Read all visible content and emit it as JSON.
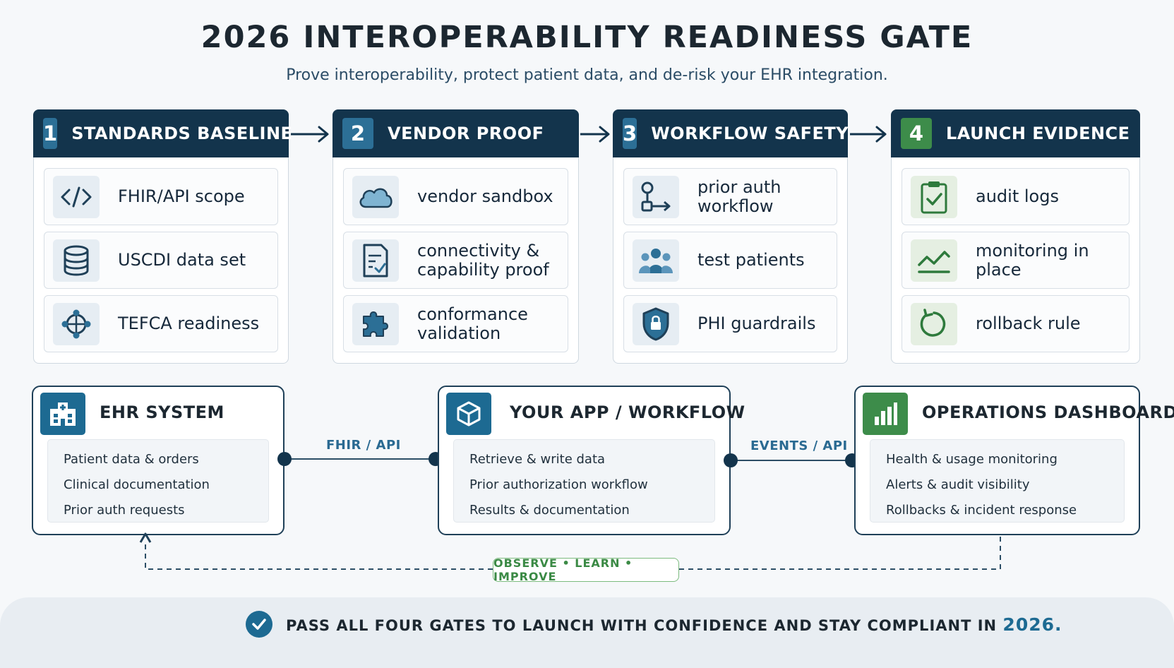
{
  "header": {
    "title": "2026 INTEROPERABILITY READINESS GATE",
    "subtitle": "Prove interoperability, protect patient data, and de-risk your EHR integration."
  },
  "gates": [
    {
      "number": "1",
      "title": "STANDARDS BASELINE",
      "items": [
        {
          "icon": "code-icon",
          "label": "FHIR/API scope"
        },
        {
          "icon": "database-icon",
          "label": "USCDI data set"
        },
        {
          "icon": "network-icon",
          "label": "TEFCA readiness"
        }
      ]
    },
    {
      "number": "2",
      "title": "VENDOR PROOF",
      "items": [
        {
          "icon": "cloud-icon",
          "label": "vendor sandbox"
        },
        {
          "icon": "checklist-icon",
          "label": "connectivity & capability proof"
        },
        {
          "icon": "puzzle-icon",
          "label": "conformance validation"
        }
      ]
    },
    {
      "number": "3",
      "title": "WORKFLOW SAFETY",
      "items": [
        {
          "icon": "workflow-icon",
          "label": "prior auth workflow"
        },
        {
          "icon": "people-icon",
          "label": "test patients"
        },
        {
          "icon": "shield-lock-icon",
          "label": "PHI guardrails"
        }
      ]
    },
    {
      "number": "4",
      "title": "LAUNCH EVIDENCE",
      "items": [
        {
          "icon": "clipboard-check-icon",
          "label": "audit logs"
        },
        {
          "icon": "trend-line-icon",
          "label": "monitoring in place"
        },
        {
          "icon": "rollback-icon",
          "label": "rollback rule"
        }
      ]
    }
  ],
  "systems": [
    {
      "icon": "hospital-icon",
      "title": "EHR SYSTEM",
      "items": [
        "Patient data & orders",
        "Clinical documentation",
        "Prior auth requests"
      ]
    },
    {
      "icon": "cube-icon",
      "title": "YOUR APP / WORKFLOW",
      "items": [
        "Retrieve & write data",
        "Prior authorization workflow",
        "Results & documentation"
      ]
    },
    {
      "icon": "bar-chart-icon",
      "title": "OPERATIONS DASHBOARD",
      "items": [
        "Health & usage monitoring",
        "Alerts & audit visibility",
        "Rollbacks & incident response"
      ]
    }
  ],
  "connectors": {
    "left": "FHIR / API",
    "right": "EVENTS / API"
  },
  "loop": {
    "label": "OBSERVE • LEARN • IMPROVE"
  },
  "footer": {
    "text": "PASS ALL FOUR GATES TO LAUNCH WITH CONFIDENCE AND STAY COMPLIANT IN",
    "year": "2026."
  },
  "colors": {
    "navy": "#13344c",
    "blue": "#1d6a92",
    "green": "#3d8c4a"
  }
}
